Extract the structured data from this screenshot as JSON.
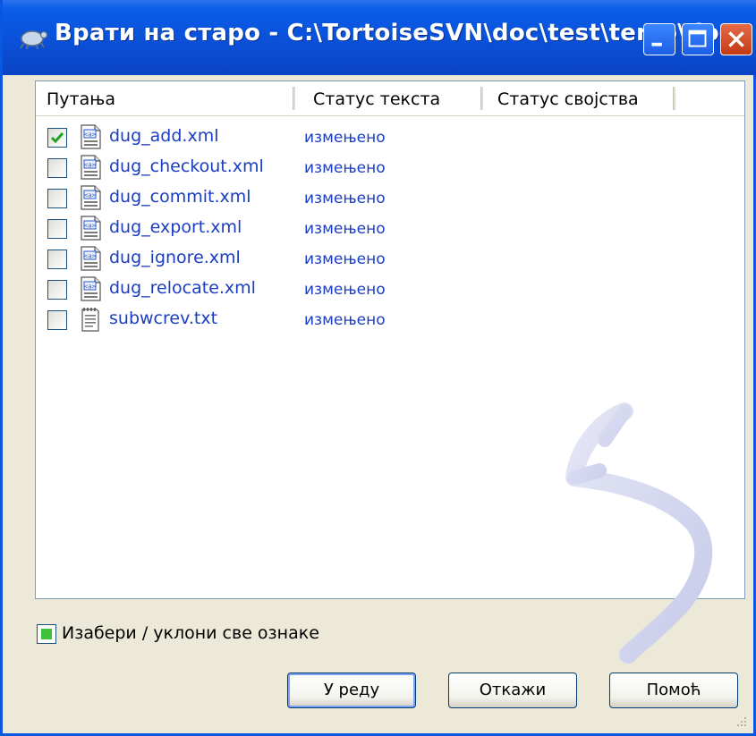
{
  "window": {
    "title": "Врати на старо - C:\\TortoiseSVN\\doc\\test\\temp\\doc",
    "colors": {
      "titlebar": "#0a4fd6",
      "close": "#c33a13",
      "link": "#1a3dc1"
    }
  },
  "list": {
    "columns": [
      "Путања",
      "Статус текста",
      "Статус својства"
    ],
    "rows": [
      {
        "name": "dug_add.xml",
        "status": "измењено",
        "checked": true,
        "icon": "xml-file-icon"
      },
      {
        "name": "dug_checkout.xml",
        "status": "измењено",
        "checked": false,
        "icon": "xml-file-icon"
      },
      {
        "name": "dug_commit.xml",
        "status": "измењено",
        "checked": false,
        "icon": "xml-file-icon"
      },
      {
        "name": "dug_export.xml",
        "status": "измењено",
        "checked": false,
        "icon": "xml-file-icon"
      },
      {
        "name": "dug_ignore.xml",
        "status": "измењено",
        "checked": false,
        "icon": "xml-file-icon"
      },
      {
        "name": "dug_relocate.xml",
        "status": "измењено",
        "checked": false,
        "icon": "xml-file-icon"
      },
      {
        "name": "subwcrev.txt",
        "status": "измењено",
        "checked": false,
        "icon": "text-file-icon"
      }
    ]
  },
  "select_all": {
    "label": "Изабери / уклони све ознаке",
    "state": "partial"
  },
  "buttons": {
    "ok": "У реду",
    "cancel": "Откажи",
    "help": "Помоћ"
  }
}
